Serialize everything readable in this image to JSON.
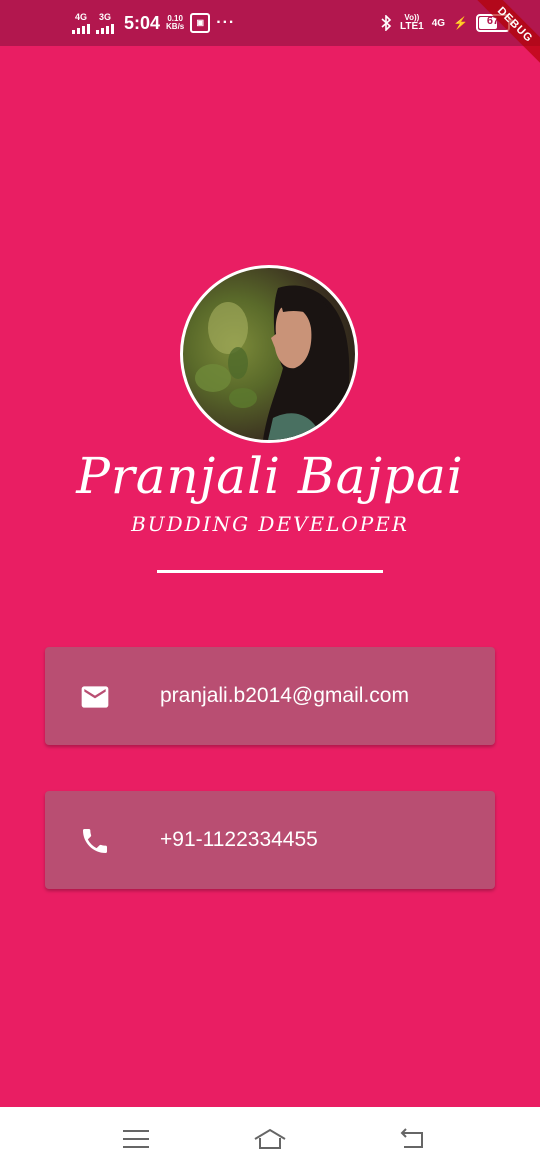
{
  "status_bar": {
    "sim1_network": "4G",
    "sim2_network": "3G",
    "time": "5:04",
    "speed_value": "0.10",
    "speed_unit": "KB/s",
    "more": "···",
    "volte_top": "Vo))",
    "volte_bottom": "LTE1",
    "network_right": "4G",
    "battery_level": "67",
    "battery_percent": 67
  },
  "debug_banner": "DEBUG",
  "profile": {
    "name": "Pranjali Bajpai",
    "title": "BUDDING DEVELOPER"
  },
  "contacts": {
    "email": "pranjali.b2014@gmail.com",
    "phone": "+91-1122334455"
  },
  "icons": {
    "email": "email-icon",
    "phone": "phone-icon",
    "menu": "menu-icon",
    "home": "home-icon",
    "back": "back-icon"
  },
  "colors": {
    "background": "#E91E63",
    "status_bar": "#B2174E",
    "card": "#B94E72",
    "text": "#FFFFFF"
  }
}
